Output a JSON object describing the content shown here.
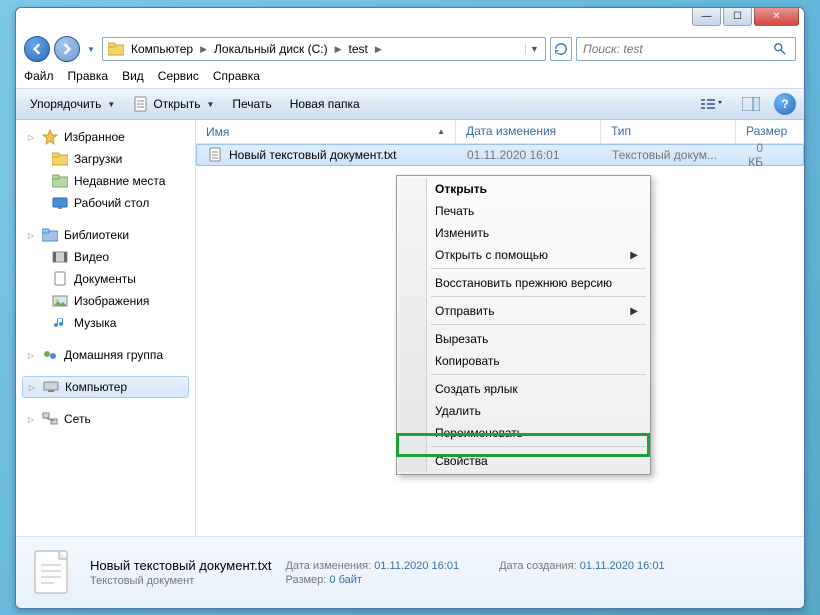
{
  "window_buttons": {
    "min": "—",
    "max": "☐",
    "close": "✕"
  },
  "nav": {
    "back": "◀",
    "forward": "▶"
  },
  "breadcrumbs": [
    "Компьютер",
    "Локальный диск (C:)",
    "test"
  ],
  "search": {
    "placeholder": "Поиск: test"
  },
  "menubar": [
    "Файл",
    "Правка",
    "Вид",
    "Сервис",
    "Справка"
  ],
  "toolbar": {
    "organize": "Упорядочить",
    "open": "Открыть",
    "print": "Печать",
    "newfolder": "Новая папка"
  },
  "sidebar": {
    "favorites": {
      "label": "Избранное",
      "items": [
        "Загрузки",
        "Недавние места",
        "Рабочий стол"
      ]
    },
    "libraries": {
      "label": "Библиотеки",
      "items": [
        "Видео",
        "Документы",
        "Изображения",
        "Музыка"
      ]
    },
    "homegroup": "Домашняя группа",
    "computer": "Компьютер",
    "network": "Сеть"
  },
  "columns": {
    "name": "Имя",
    "date": "Дата изменения",
    "type": "Тип",
    "size": "Размер"
  },
  "file": {
    "name": "Новый текстовый документ.txt",
    "date": "01.11.2020 16:01",
    "type": "Текстовый докум...",
    "size": "0 КБ"
  },
  "context_menu": {
    "open": "Открыть",
    "print": "Печать",
    "edit": "Изменить",
    "open_with": "Открыть с помощью",
    "restore": "Восстановить прежнюю версию",
    "send_to": "Отправить",
    "cut": "Вырезать",
    "copy": "Копировать",
    "shortcut": "Создать ярлык",
    "delete": "Удалить",
    "rename": "Переименовать",
    "properties": "Свойства"
  },
  "details": {
    "title": "Новый текстовый документ.txt",
    "subtitle": "Текстовый документ",
    "modified_label": "Дата изменения:",
    "modified": "01.11.2020 16:01",
    "created_label": "Дата создания:",
    "created": "01.11.2020 16:01",
    "size_label": "Размер:",
    "size": "0 байт"
  }
}
